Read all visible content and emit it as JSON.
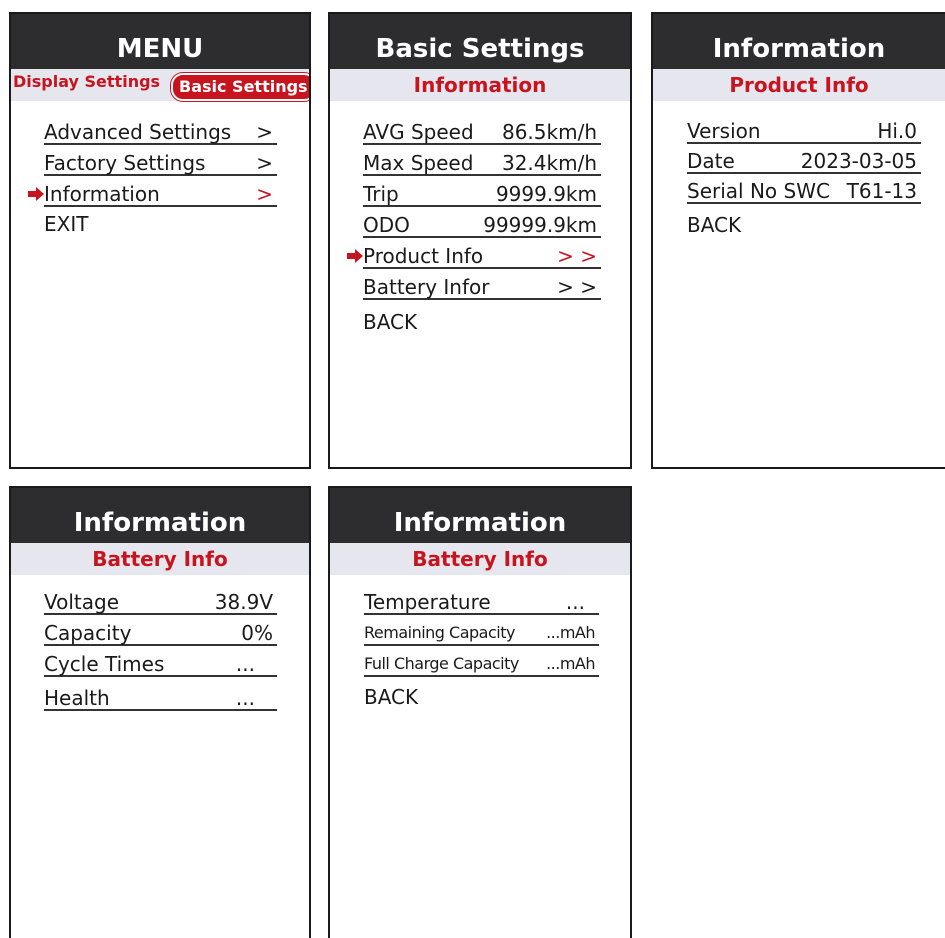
{
  "panel1": {
    "title": "MENU",
    "tab_left": "Display Settings",
    "tab_right": "Basic Settings",
    "items": [
      {
        "label": "Advanced Settings",
        "value": ">"
      },
      {
        "label": "Factory Settings",
        "value": ">"
      },
      {
        "label": "Information",
        "value": ">"
      },
      {
        "label": "EXIT"
      }
    ]
  },
  "panel2": {
    "title": "Basic Settings",
    "subtitle": "Information",
    "items": [
      {
        "label": "AVG Speed",
        "value": "86.5km/h"
      },
      {
        "label": "Max Speed",
        "value": "32.4km/h"
      },
      {
        "label": "Trip",
        "value": "9999.9km"
      },
      {
        "label": "ODO",
        "value": "99999.9km"
      },
      {
        "label": "Product Info",
        "value": "> >"
      },
      {
        "label": "Battery Infor",
        "value": "> >"
      },
      {
        "label": "BACK"
      }
    ]
  },
  "panel3": {
    "title": "Information",
    "subtitle": "Product Info",
    "items": [
      {
        "label": "Version",
        "value": "Hi.0"
      },
      {
        "label": "Date",
        "value": "2023-03-05"
      },
      {
        "label": "Serial No SWC",
        "value": "T61-13"
      },
      {
        "label": "BACK"
      }
    ]
  },
  "panel4": {
    "title": "Information",
    "subtitle": "Battery Info",
    "items": [
      {
        "label": "Voltage",
        "value": "38.9V"
      },
      {
        "label": "Capacity",
        "value": "0%"
      },
      {
        "label": "Cycle Times",
        "value": "..."
      },
      {
        "label": "Health",
        "value": "..."
      }
    ]
  },
  "panel5": {
    "title": "Information",
    "subtitle": "Battery Info",
    "items": [
      {
        "label": "Temperature",
        "value": "..."
      },
      {
        "label": "Remaining Capacity",
        "value": "...mAh"
      },
      {
        "label": "Full Charge Capacity",
        "value": "...mAh"
      },
      {
        "label": "BACK"
      }
    ]
  },
  "colors": {
    "accent": "#c8141e",
    "header": "#2d2d30",
    "subheader": "#e6e6ee"
  },
  "icons": {
    "selection": "right-arrow-icon"
  }
}
